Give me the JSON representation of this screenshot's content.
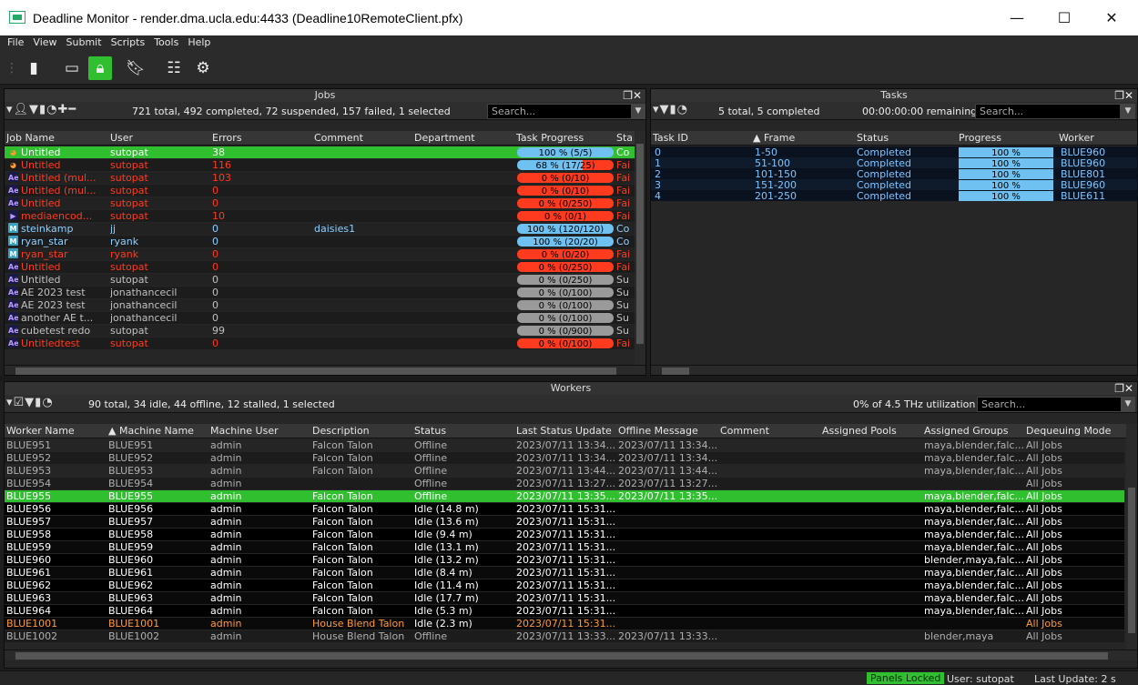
{
  "window": {
    "title": "Deadline Monitor  -  render.dma.ucla.edu:4433 (Deadline10RemoteClient.pfx)",
    "minimize": "—",
    "maximize": "☐",
    "close": "✕"
  },
  "menu": [
    "File",
    "View",
    "Submit",
    "Scripts",
    "Tools",
    "Help"
  ],
  "toolbar": {
    "icons": [
      "menu-grip-icon",
      "phone-icon",
      "window-icon",
      "lock-icon",
      "bookmark-icon",
      "settings-list-icon",
      "gear-icon"
    ],
    "active": "lock-icon"
  },
  "jobs": {
    "title": "Jobs",
    "summary": "721 total, 492 completed, 72 suspended, 157 failed, 1 selected",
    "search_placeholder": "Search...",
    "columns": [
      "Job Name",
      "User",
      "Errors",
      "Comment",
      "Department",
      "Task Progress",
      "Sta"
    ],
    "rows": [
      {
        "icon": "blender",
        "name": "Untitled",
        "user": "sutopat",
        "errors": "38",
        "comment": "",
        "progress": "100 %  (5/5)",
        "pct": 100,
        "status": "Co",
        "state": "selected"
      },
      {
        "icon": "blender",
        "name": "Untitled",
        "user": "sutopat",
        "errors": "116",
        "comment": "",
        "progress": "68 %  (17/25)",
        "pct": 68,
        "status": "Fai",
        "state": "failed"
      },
      {
        "icon": "ae",
        "name": "Untitled (mul...",
        "user": "sutopat",
        "errors": "103",
        "comment": "",
        "progress": "0 %  (0/10)",
        "pct": 0,
        "status": "Fai",
        "state": "failed"
      },
      {
        "icon": "ae",
        "name": "Untitled (mul...",
        "user": "sutopat",
        "errors": "0",
        "comment": "",
        "progress": "0 %  (0/10)",
        "pct": 0,
        "status": "Fai",
        "state": "failed"
      },
      {
        "icon": "ae",
        "name": "Untitled",
        "user": "sutopat",
        "errors": "0",
        "comment": "",
        "progress": "0 %  (0/250)",
        "pct": 0,
        "status": "Fai",
        "state": "failed"
      },
      {
        "icon": "media",
        "name": "mediaencod...",
        "user": "sutopat",
        "errors": "10",
        "comment": "",
        "progress": "0 %  (0/1)",
        "pct": 0,
        "status": "Fai",
        "state": "failed"
      },
      {
        "icon": "maya",
        "name": "steinkamp",
        "user": "jj",
        "errors": "0",
        "comment": "daisies1",
        "progress": "100 %  (120/120)",
        "pct": 100,
        "status": "Co",
        "state": "completed"
      },
      {
        "icon": "maya",
        "name": "ryan_star",
        "user": "ryank",
        "errors": "0",
        "comment": "",
        "progress": "100 %  (20/20)",
        "pct": 100,
        "status": "Co",
        "state": "completed"
      },
      {
        "icon": "maya",
        "name": "ryan_star",
        "user": "ryank",
        "errors": "0",
        "comment": "",
        "progress": "0 %  (0/20)",
        "pct": 0,
        "status": "Fai",
        "state": "failed"
      },
      {
        "icon": "ae",
        "name": "Untitled",
        "user": "sutopat",
        "errors": "0",
        "comment": "",
        "progress": "0 %  (0/250)",
        "pct": 0,
        "status": "Fai",
        "state": "failed"
      },
      {
        "icon": "ae",
        "name": "Untitled",
        "user": "sutopat",
        "errors": "0",
        "comment": "",
        "progress": "0 %  (0/250)",
        "pct": 0,
        "status": "Su",
        "state": "suspended"
      },
      {
        "icon": "ae",
        "name": "AE 2023 test",
        "user": "jonathancecil",
        "errors": "0",
        "comment": "",
        "progress": "0 %  (0/100)",
        "pct": 0,
        "status": "Su",
        "state": "suspended"
      },
      {
        "icon": "ae",
        "name": "AE 2023 test",
        "user": "jonathancecil",
        "errors": "0",
        "comment": "",
        "progress": "0 %  (0/100)",
        "pct": 0,
        "status": "Su",
        "state": "suspended"
      },
      {
        "icon": "ae",
        "name": "another AE t...",
        "user": "jonathancecil",
        "errors": "0",
        "comment": "",
        "progress": "0 %  (0/100)",
        "pct": 0,
        "status": "Su",
        "state": "suspended"
      },
      {
        "icon": "ae",
        "name": "cubetest redo",
        "user": "sutopat",
        "errors": "99",
        "comment": "",
        "progress": "0 %  (0/900)",
        "pct": 0,
        "status": "Su",
        "state": "suspended"
      },
      {
        "icon": "ae",
        "name": "Untitledtest",
        "user": "sutopat",
        "errors": "0",
        "comment": "",
        "progress": "0 %  (0/100)",
        "pct": 0,
        "status": "Fai",
        "state": "failed"
      }
    ]
  },
  "tasks": {
    "title": "Tasks",
    "summary": "5 total, 5 completed",
    "remaining": "00:00:00:00 remaining",
    "search_placeholder": "Search...",
    "columns": [
      "Task ID",
      "▲ Frame",
      "Status",
      "Progress",
      "Worker"
    ],
    "rows": [
      {
        "id": "0",
        "frame": "1-50",
        "status": "Completed",
        "progress": "100 %",
        "worker": "BLUE960"
      },
      {
        "id": "1",
        "frame": "51-100",
        "status": "Completed",
        "progress": "100 %",
        "worker": "BLUE960"
      },
      {
        "id": "2",
        "frame": "101-150",
        "status": "Completed",
        "progress": "100 %",
        "worker": "BLUE801"
      },
      {
        "id": "3",
        "frame": "151-200",
        "status": "Completed",
        "progress": "100 %",
        "worker": "BLUE960"
      },
      {
        "id": "4",
        "frame": "201-250",
        "status": "Completed",
        "progress": "100 %",
        "worker": "BLUE611"
      }
    ]
  },
  "workers": {
    "title": "Workers",
    "summary": "90 total, 34 idle, 44 offline, 12 stalled, 1 selected",
    "utilization": "0% of 4.5 THz utilization",
    "search_placeholder": "Search...",
    "columns": [
      "Worker Name",
      "▲ Machine Name",
      "Machine User",
      "Description",
      "Status",
      "Last Status Update",
      "Offline Message",
      "Comment",
      "Assigned Pools",
      "Assigned Groups",
      "Dequeuing Mode"
    ],
    "rows": [
      {
        "name": "BLUE951",
        "machine": "BLUE951",
        "muser": "admin",
        "desc": "Falcon Talon",
        "status": "Offline",
        "last": "2023/07/11 13:34...",
        "offline": "2023/07/11 13:34...",
        "groups": "maya,blender,falc...",
        "mode": "All Jobs",
        "state": "offline"
      },
      {
        "name": "BLUE952",
        "machine": "BLUE952",
        "muser": "admin",
        "desc": "Falcon Talon",
        "status": "Offline",
        "last": "2023/07/11 13:34...",
        "offline": "2023/07/11 13:34...",
        "groups": "maya,blender,falc...",
        "mode": "All Jobs",
        "state": "offline"
      },
      {
        "name": "BLUE953",
        "machine": "BLUE953",
        "muser": "admin",
        "desc": "Falcon Talon",
        "status": "Offline",
        "last": "2023/07/11 13:44...",
        "offline": "2023/07/11 13:44...",
        "groups": "maya,blender,falc...",
        "mode": "All Jobs",
        "state": "offline"
      },
      {
        "name": "BLUE954",
        "machine": "BLUE954",
        "muser": "admin",
        "desc": "",
        "status": "Offline",
        "last": "2023/07/11 13:27...",
        "offline": "2023/07/11 13:27...",
        "groups": "",
        "mode": "All Jobs",
        "state": "offline"
      },
      {
        "name": "BLUE955",
        "machine": "BLUE955",
        "muser": "admin",
        "desc": "Falcon Talon",
        "status": "Offline",
        "last": "2023/07/11 13:35...",
        "offline": "2023/07/11 13:35...",
        "groups": "maya,blender,falc...",
        "mode": "All Jobs",
        "state": "selected"
      },
      {
        "name": "BLUE956",
        "machine": "BLUE956",
        "muser": "admin",
        "desc": "Falcon Talon",
        "status": "Idle (14.8 m)",
        "last": "2023/07/11 15:31...",
        "offline": "",
        "groups": "maya,blender,falc...",
        "mode": "All Jobs",
        "state": "idle"
      },
      {
        "name": "BLUE957",
        "machine": "BLUE957",
        "muser": "admin",
        "desc": "Falcon Talon",
        "status": "Idle (13.6 m)",
        "last": "2023/07/11 15:31...",
        "offline": "",
        "groups": "maya,blender,falc...",
        "mode": "All Jobs",
        "state": "idle"
      },
      {
        "name": "BLUE958",
        "machine": "BLUE958",
        "muser": "admin",
        "desc": "Falcon Talon",
        "status": "Idle (9.4 m)",
        "last": "2023/07/11 15:31...",
        "offline": "",
        "groups": "maya,blender,falc...",
        "mode": "All Jobs",
        "state": "idle"
      },
      {
        "name": "BLUE959",
        "machine": "BLUE959",
        "muser": "admin",
        "desc": "Falcon Talon",
        "status": "Idle (13.1 m)",
        "last": "2023/07/11 15:31...",
        "offline": "",
        "groups": "maya,blender,falc...",
        "mode": "All Jobs",
        "state": "idle"
      },
      {
        "name": "BLUE960",
        "machine": "BLUE960",
        "muser": "admin",
        "desc": "Falcon Talon",
        "status": "Idle (13.2 m)",
        "last": "2023/07/11 15:31...",
        "offline": "",
        "groups": "blender,maya,falc...",
        "mode": "All Jobs",
        "state": "idle"
      },
      {
        "name": "BLUE961",
        "machine": "BLUE961",
        "muser": "admin",
        "desc": "Falcon Talon",
        "status": "Idle (8.4 m)",
        "last": "2023/07/11 15:31...",
        "offline": "",
        "groups": "maya,blender,falc...",
        "mode": "All Jobs",
        "state": "idle"
      },
      {
        "name": "BLUE962",
        "machine": "BLUE962",
        "muser": "admin",
        "desc": "Falcon Talon",
        "status": "Idle (11.4 m)",
        "last": "2023/07/11 15:31...",
        "offline": "",
        "groups": "maya,blender,falc...",
        "mode": "All Jobs",
        "state": "idle"
      },
      {
        "name": "BLUE963",
        "machine": "BLUE963",
        "muser": "admin",
        "desc": "Falcon Talon",
        "status": "Idle (17.7 m)",
        "last": "2023/07/11 15:31...",
        "offline": "",
        "groups": "maya,blender,falc...",
        "mode": "All Jobs",
        "state": "idle"
      },
      {
        "name": "BLUE964",
        "machine": "BLUE964",
        "muser": "admin",
        "desc": "Falcon Talon",
        "status": "Idle (5.3 m)",
        "last": "2023/07/11 15:31...",
        "offline": "",
        "groups": "maya,blender,falc...",
        "mode": "All Jobs",
        "state": "idle"
      },
      {
        "name": "BLUE1001",
        "machine": "BLUE1001",
        "muser": "admin",
        "desc": "House Blend Talon",
        "status": "Idle (2.3 m)",
        "last": "2023/07/11 15:31...",
        "offline": "",
        "groups": "",
        "mode": "All Jobs",
        "state": "idle-orange"
      },
      {
        "name": "BLUE1002",
        "machine": "BLUE1002",
        "muser": "admin",
        "desc": "House Blend Talon",
        "status": "Offline",
        "last": "2023/07/11 13:33...",
        "offline": "2023/07/11 13:33...",
        "groups": "blender,maya",
        "mode": "All Jobs",
        "state": "offline"
      }
    ]
  },
  "status_bar": {
    "panels_locked": "Panels Locked",
    "user": "User: sutopat",
    "last_update": "Last Update: 2 s"
  },
  "colors": {
    "selected_green": "#2fbf2f",
    "failed_red": "#ff3b1f",
    "completed_cyan": "#6ec1f0",
    "suspended_gray": "#9a9a9a",
    "pending_orange": "#ff9933",
    "offline_text": "#b0b0b0"
  }
}
